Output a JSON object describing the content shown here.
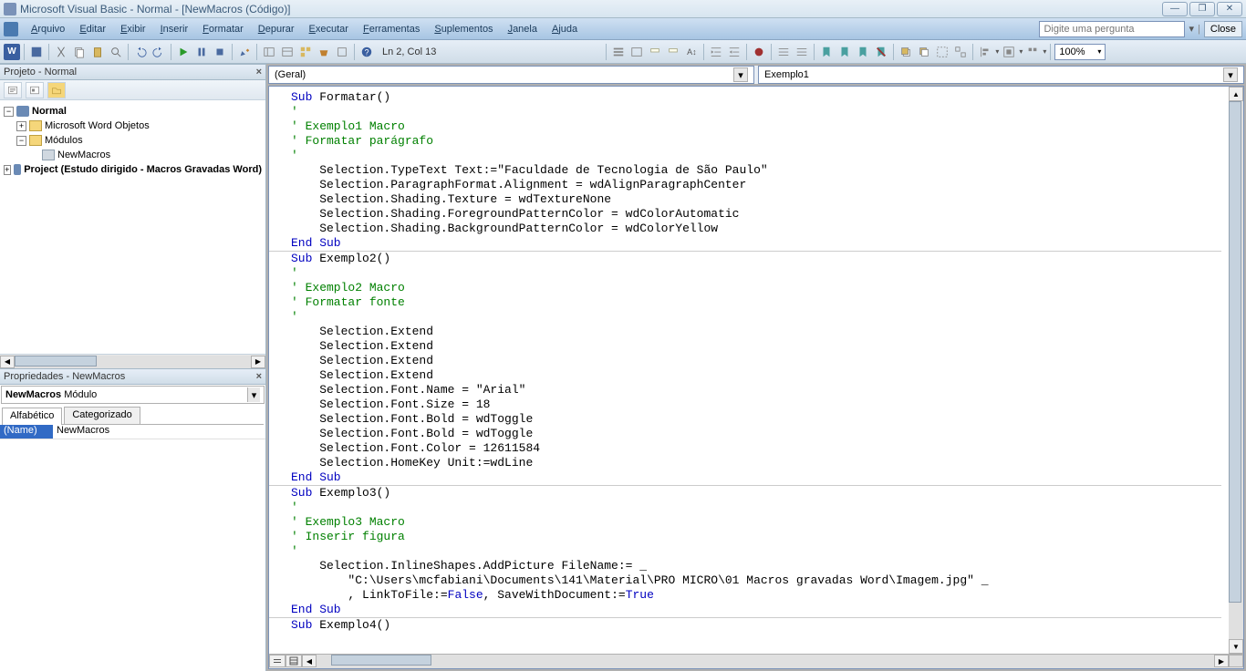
{
  "titlebar": {
    "text": "Microsoft Visual Basic - Normal - [NewMacros (Código)]"
  },
  "menubar": {
    "items": [
      "Arquivo",
      "Editar",
      "Exibir",
      "Inserir",
      "Formatar",
      "Depurar",
      "Executar",
      "Ferramentas",
      "Suplementos",
      "Janela",
      "Ajuda"
    ],
    "help_placeholder": "Digite uma pergunta",
    "close_label": "Close"
  },
  "toolbar": {
    "cursor_pos": "Ln 2, Col 13",
    "zoom": "100%"
  },
  "project_panel": {
    "title": "Projeto - Normal",
    "tree": {
      "root1": "Normal",
      "child1": "Microsoft Word Objetos",
      "child2": "Módulos",
      "leaf": "NewMacros",
      "root2": "Project (Estudo dirigido - Macros Gravadas Word)"
    }
  },
  "props_panel": {
    "title": "Propriedades - NewMacros",
    "dropdown_bold": "NewMacros",
    "dropdown_rest": " Módulo",
    "tabs": [
      "Alfabético",
      "Categorizado"
    ],
    "rows": [
      {
        "name": "(Name)",
        "value": "NewMacros"
      }
    ]
  },
  "code": {
    "left_dropdown": "(Geral)",
    "right_dropdown": "Exemplo1",
    "lines": [
      {
        "t": "kw",
        "s": "Sub "
      },
      {
        "t": "",
        "s": "Formatar()"
      },
      {
        "br": 1
      },
      {
        "t": "cm",
        "s": "'"
      },
      {
        "br": 1
      },
      {
        "t": "cm",
        "s": "' Exemplo1 Macro"
      },
      {
        "br": 1
      },
      {
        "t": "cm",
        "s": "' Formatar parágrafo"
      },
      {
        "br": 1
      },
      {
        "t": "cm",
        "s": "'"
      },
      {
        "br": 1
      },
      {
        "t": "",
        "s": "    Selection.TypeText Text:=\"Faculdade de Tecnologia de São Paulo\""
      },
      {
        "br": 1
      },
      {
        "t": "",
        "s": "    Selection.ParagraphFormat.Alignment = wdAlignParagraphCenter"
      },
      {
        "br": 1
      },
      {
        "t": "",
        "s": "    Selection.Shading.Texture = wdTextureNone"
      },
      {
        "br": 1
      },
      {
        "t": "",
        "s": "    Selection.Shading.ForegroundPatternColor = wdColorAutomatic"
      },
      {
        "br": 1
      },
      {
        "t": "",
        "s": "    Selection.Shading.BackgroundPatternColor = wdColorYellow"
      },
      {
        "br": 1
      },
      {
        "t": "kw",
        "s": "End Sub"
      },
      {
        "br": 1
      },
      {
        "hr": 1
      },
      {
        "t": "kw",
        "s": "Sub "
      },
      {
        "t": "",
        "s": "Exemplo2()"
      },
      {
        "br": 1
      },
      {
        "t": "cm",
        "s": "'"
      },
      {
        "br": 1
      },
      {
        "t": "cm",
        "s": "' Exemplo2 Macro"
      },
      {
        "br": 1
      },
      {
        "t": "cm",
        "s": "' Formatar fonte"
      },
      {
        "br": 1
      },
      {
        "t": "cm",
        "s": "'"
      },
      {
        "br": 1
      },
      {
        "t": "",
        "s": "    Selection.Extend"
      },
      {
        "br": 1
      },
      {
        "t": "",
        "s": "    Selection.Extend"
      },
      {
        "br": 1
      },
      {
        "t": "",
        "s": "    Selection.Extend"
      },
      {
        "br": 1
      },
      {
        "t": "",
        "s": "    Selection.Extend"
      },
      {
        "br": 1
      },
      {
        "t": "",
        "s": "    Selection.Font.Name = \"Arial\""
      },
      {
        "br": 1
      },
      {
        "t": "",
        "s": "    Selection.Font.Size = 18"
      },
      {
        "br": 1
      },
      {
        "t": "",
        "s": "    Selection.Font.Bold = wdToggle"
      },
      {
        "br": 1
      },
      {
        "t": "",
        "s": "    Selection.Font.Bold = wdToggle"
      },
      {
        "br": 1
      },
      {
        "t": "",
        "s": "    Selection.Font.Color = 12611584"
      },
      {
        "br": 1
      },
      {
        "t": "",
        "s": "    Selection.HomeKey Unit:=wdLine"
      },
      {
        "br": 1
      },
      {
        "t": "kw",
        "s": "End Sub"
      },
      {
        "br": 1
      },
      {
        "hr": 1
      },
      {
        "t": "kw",
        "s": "Sub "
      },
      {
        "t": "",
        "s": "Exemplo3()"
      },
      {
        "br": 1
      },
      {
        "t": "cm",
        "s": "'"
      },
      {
        "br": 1
      },
      {
        "t": "cm",
        "s": "' Exemplo3 Macro"
      },
      {
        "br": 1
      },
      {
        "t": "cm",
        "s": "' Inserir figura"
      },
      {
        "br": 1
      },
      {
        "t": "cm",
        "s": "'"
      },
      {
        "br": 1
      },
      {
        "t": "",
        "s": "    Selection.InlineShapes.AddPicture FileName:= _"
      },
      {
        "br": 1
      },
      {
        "t": "",
        "s": "        \"C:\\Users\\mcfabiani\\Documents\\141\\Material\\PRO MICRO\\01 Macros gravadas Word\\Imagem.jpg\" _"
      },
      {
        "br": 1
      },
      {
        "t": "",
        "s": "        , LinkToFile:="
      },
      {
        "t": "kw",
        "s": "False"
      },
      {
        "t": "",
        "s": ", SaveWithDocument:="
      },
      {
        "t": "kw",
        "s": "True"
      },
      {
        "br": 1
      },
      {
        "t": "kw",
        "s": "End Sub"
      },
      {
        "br": 1
      },
      {
        "hr": 1
      },
      {
        "t": "kw",
        "s": "Sub "
      },
      {
        "t": "",
        "s": "Exemplo4()"
      },
      {
        "br": 1
      }
    ]
  }
}
